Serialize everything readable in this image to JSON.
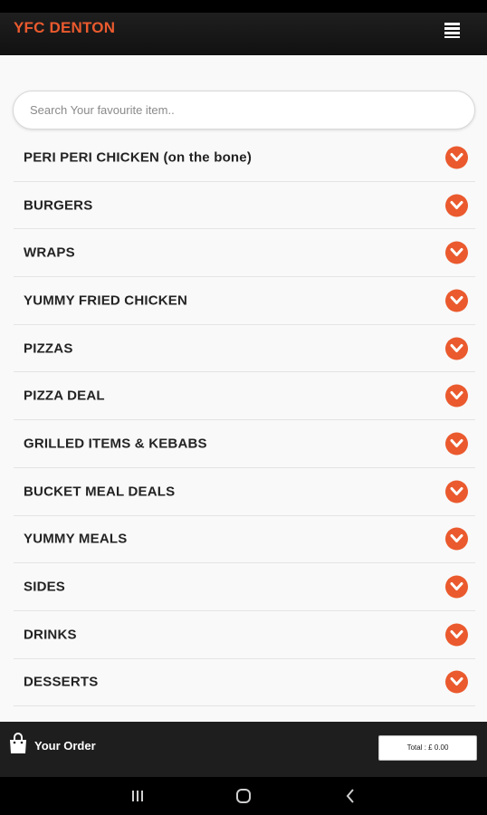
{
  "header": {
    "brand": "YFC DENTON",
    "menu_icon": "hamburger-menu-icon"
  },
  "search": {
    "placeholder": "Search Your favourite item.."
  },
  "categories": [
    "PERI PERI CHICKEN (on the bone)",
    "BURGERS",
    "WRAPS",
    "YUMMY FRIED CHICKEN",
    "PIZZAS",
    "PIZZA DEAL",
    "GRILLED ITEMS & KEBABS",
    "BUCKET MEAL DEALS",
    "YUMMY MEALS",
    "SIDES",
    "DRINKS",
    "DESSERTS"
  ],
  "order_bar": {
    "label": "Your Order",
    "total": "Total : £ 0.00",
    "icon": "shopping-bag-icon"
  },
  "colors": {
    "accent": "#ea5a2e",
    "header_bg": "#1a1a1a",
    "order_bar_bg": "#1e1e1e"
  },
  "navigation": {
    "icons": [
      "recent-apps-icon",
      "home-icon",
      "back-icon"
    ]
  }
}
